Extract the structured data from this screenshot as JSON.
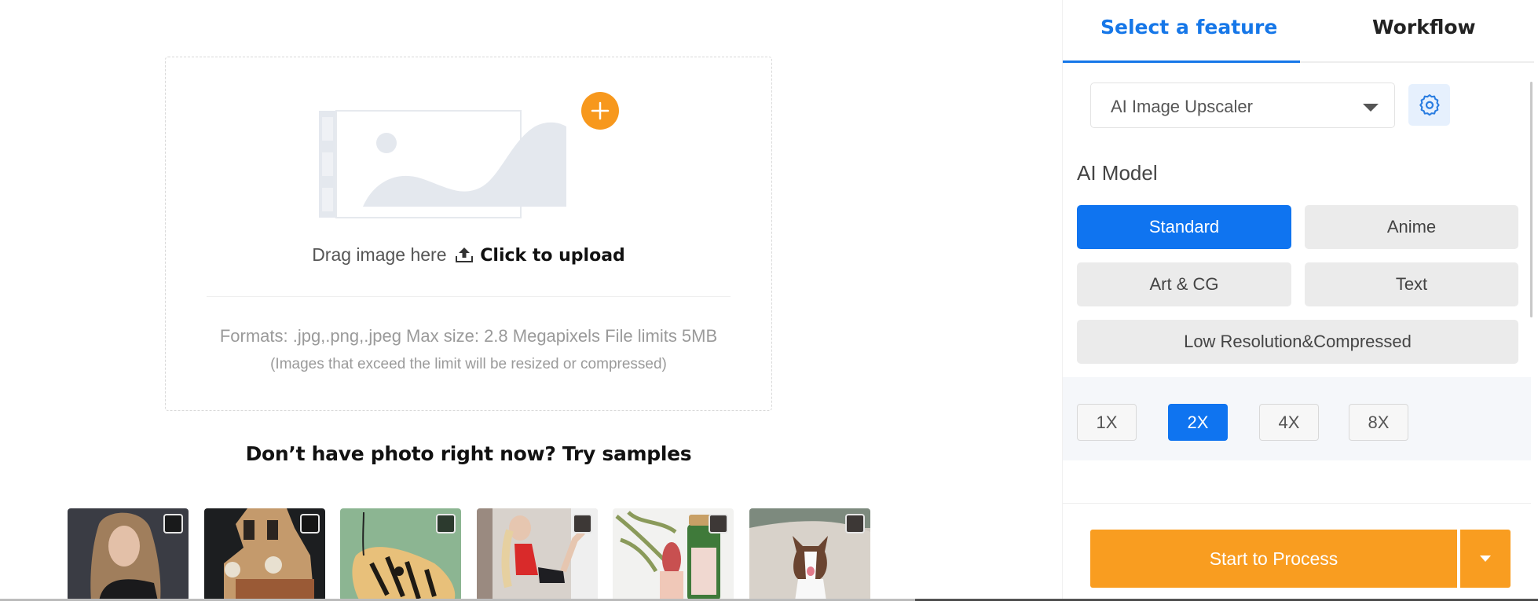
{
  "upload": {
    "drag_text": "Drag image here",
    "click_text": "Click to upload",
    "formats": "Formats: .jpg,.png,.jpeg Max size: 2.8 Megapixels File limits 5MB",
    "formats_note": "(Images that exceed the limit will be resized or compressed)"
  },
  "samples": {
    "title": "Don’t have photo right now? Try samples",
    "items": [
      {
        "name": "portrait-woman",
        "checked": false
      },
      {
        "name": "clock-tower",
        "checked": false
      },
      {
        "name": "butterfly",
        "checked": false
      },
      {
        "name": "fitness-woman",
        "checked": false
      },
      {
        "name": "green-bottle-product",
        "checked": false
      },
      {
        "name": "dog",
        "checked": false
      }
    ]
  },
  "panel": {
    "tabs": [
      {
        "label": "Select a feature",
        "active": true
      },
      {
        "label": "Workflow",
        "active": false
      }
    ],
    "feature_select": {
      "value": "AI Image Upscaler"
    },
    "ai_model": {
      "label": "AI Model",
      "options": [
        {
          "label": "Standard",
          "active": true
        },
        {
          "label": "Anime",
          "active": false
        },
        {
          "label": "Art & CG",
          "active": false
        },
        {
          "label": "Text",
          "active": false
        },
        {
          "label": "Low Resolution&Compressed",
          "active": false
        }
      ]
    },
    "scale": {
      "options": [
        {
          "label": "1X",
          "active": false
        },
        {
          "label": "2X",
          "active": true
        },
        {
          "label": "4X",
          "active": false
        },
        {
          "label": "8X",
          "active": false
        }
      ]
    },
    "start_button": "Start to Process"
  },
  "colors": {
    "accent_blue": "#0f74f0",
    "tab_blue": "#1677e8",
    "orange": "#f99d20"
  }
}
